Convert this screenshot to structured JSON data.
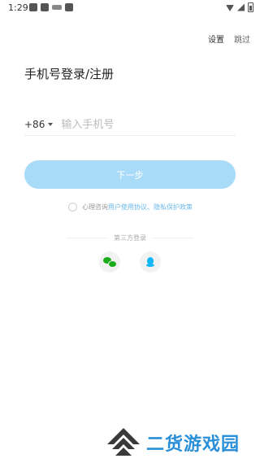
{
  "status_bar": {
    "time": "1:29"
  },
  "header": {
    "settings_label": "设置",
    "skip_label": "跳过"
  },
  "title": "手机号登录/注册",
  "phone": {
    "country_code": "+86",
    "placeholder": "输入手机号",
    "value": ""
  },
  "next_button": {
    "label": "下一步"
  },
  "agreement": {
    "prefix": "心理咨询",
    "user_agreement": "用户使用协议",
    "separator": "、",
    "privacy_policy": "隐私保护政策"
  },
  "third_party": {
    "label": "第三方登录"
  },
  "watermark": {
    "text": "二货游戏园"
  },
  "colors": {
    "accent": "#a7dbf8",
    "link": "#6ab8ea",
    "wechat": "#1aad19",
    "qq": "#12b7f5",
    "watermark": "#2b8fd8"
  }
}
